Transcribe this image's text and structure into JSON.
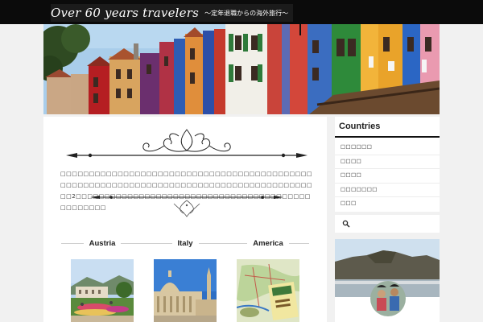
{
  "header": {
    "site_title": "Over 60 years travelers",
    "site_subtitle": "〜定年退職からの海外旅行〜"
  },
  "main": {
    "intro_text": "□□□□□□□□□□□□□□□□□□□□□□□□□□□□□□□□□□□□□□□□□□□□□□□□□□□□□□□□□□□□□□□□□□□□□□□□□□□□□□□□□□□□□□□□□□2□□□□□□□□□□□□□□□□□□□□□□□□□□□□□□□□□□□□□□□□□□□□□□□□□",
    "countries": [
      {
        "name": "Austria"
      },
      {
        "name": "Italy"
      },
      {
        "name": "America"
      }
    ]
  },
  "sidebar": {
    "countries_title": "Countries",
    "links": [
      "□□□□□□",
      "□□□□",
      "□□□□",
      "□□□□□□□",
      "□□□"
    ],
    "search_placeholder": ""
  },
  "colors": {
    "header_bg": "#0b0b0b",
    "page_bg": "#f1f1f1",
    "panel_bg": "#ffffff"
  }
}
